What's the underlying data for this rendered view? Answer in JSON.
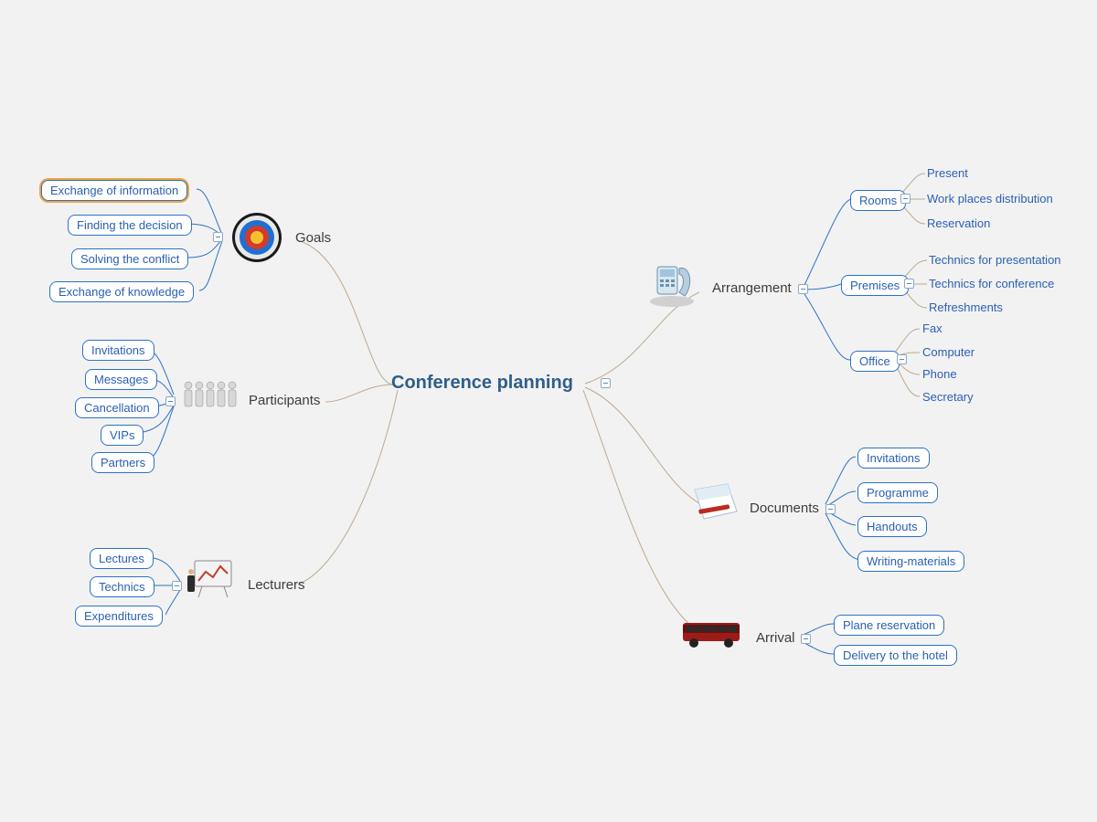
{
  "center": "Conference planning",
  "goals": {
    "label": "Goals",
    "items": [
      "Exchange of information",
      "Finding the decision",
      "Solving the conflict",
      "Exchange of knowledge"
    ]
  },
  "participants": {
    "label": "Participants",
    "items": [
      "Invitations",
      "Messages",
      "Cancellation",
      "VIPs",
      "Partners"
    ]
  },
  "lecturers": {
    "label": "Lecturers",
    "items": [
      "Lectures",
      "Technics",
      "Expenditures"
    ]
  },
  "arrangement": {
    "label": "Arrangement",
    "rooms": {
      "label": "Rooms",
      "items": [
        "Present",
        "Work places distribution",
        "Reservation"
      ]
    },
    "premises": {
      "label": "Premises",
      "items": [
        "Technics for presentation",
        "Technics for conference",
        "Refreshments"
      ]
    },
    "office": {
      "label": "Office",
      "items": [
        "Fax",
        "Computer",
        "Phone",
        "Secretary"
      ]
    }
  },
  "documents": {
    "label": "Documents",
    "items": [
      "Invitations",
      "Programme",
      "Handouts",
      "Writing-materials"
    ]
  },
  "arrival": {
    "label": "Arrival",
    "items": [
      "Plane reservation",
      "Delivery to the hotel"
    ]
  }
}
